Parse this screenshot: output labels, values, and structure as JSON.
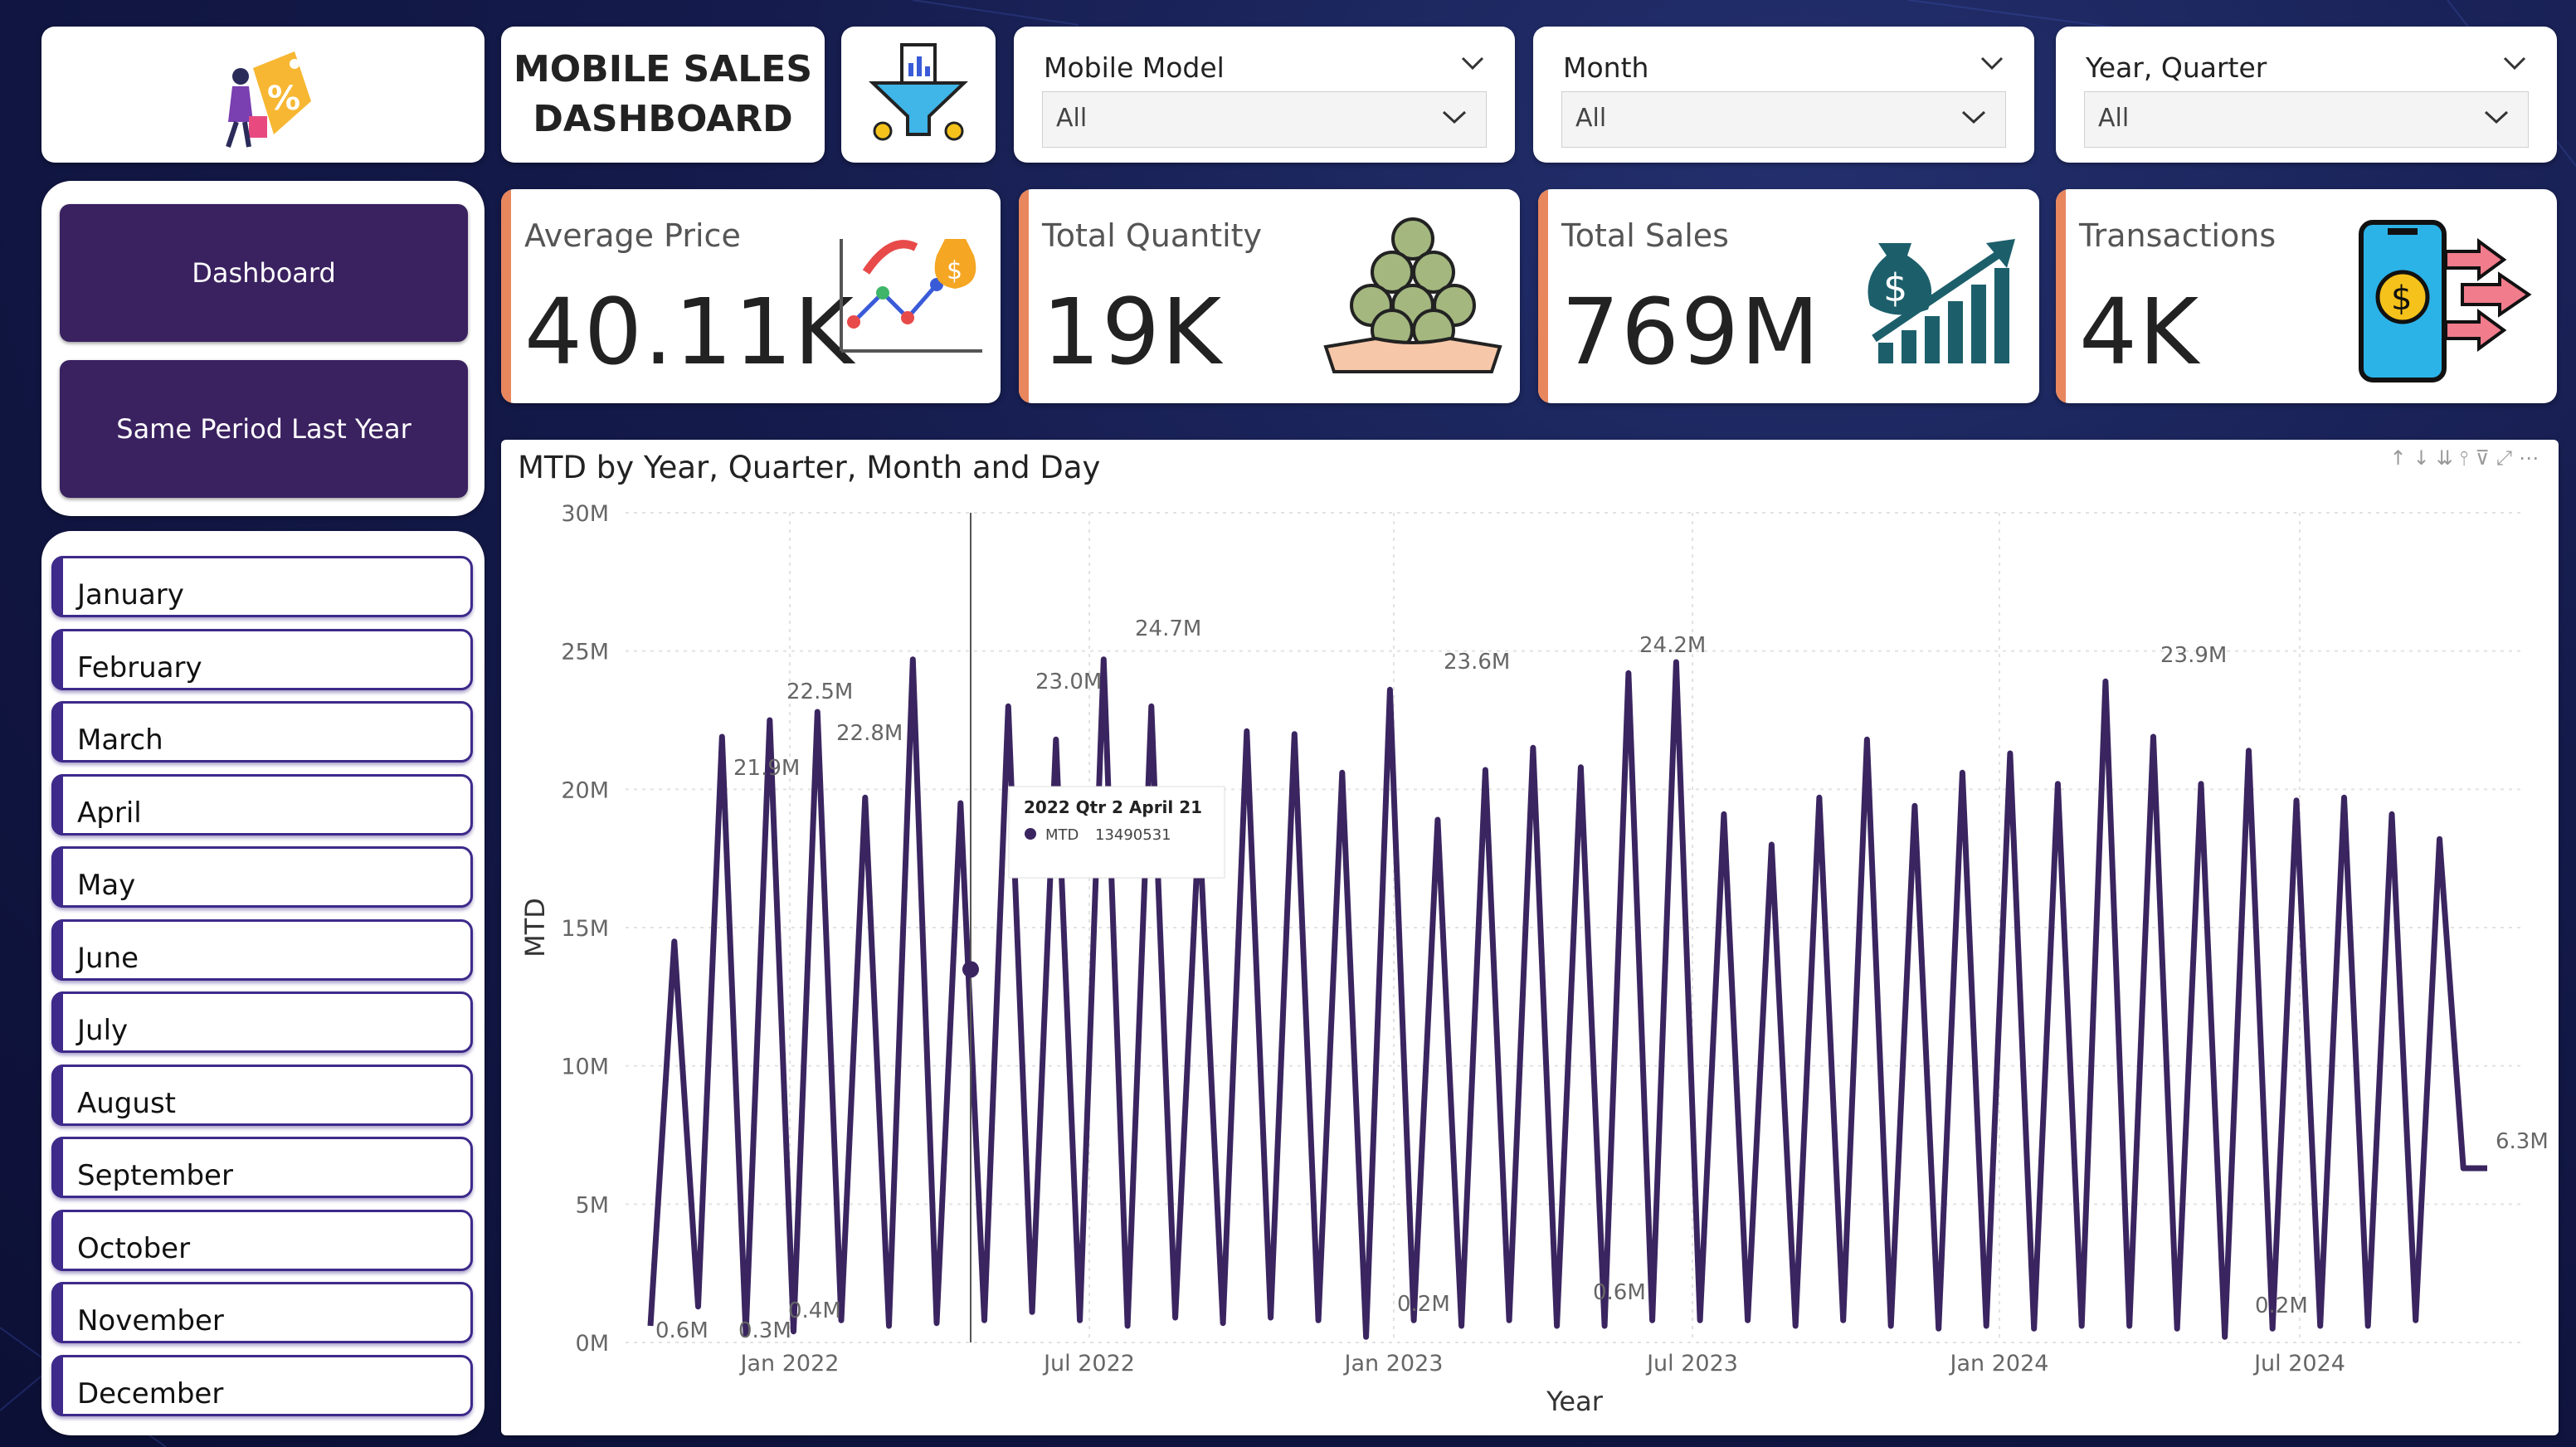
{
  "title": {
    "line1": "MOBILE SALES",
    "line2": "DASHBOARD"
  },
  "logo_icon": "discount-tag-shopper-icon",
  "filter_icon": "funnel-chart-icon",
  "slicers": [
    {
      "header": "Mobile Model",
      "value": "All"
    },
    {
      "header": "Month",
      "value": "All"
    },
    {
      "header": "Year, Quarter",
      "value": "All"
    }
  ],
  "nav": {
    "dashboard": "Dashboard",
    "same_period": "Same Period Last Year"
  },
  "months": [
    "January",
    "February",
    "March",
    "April",
    "May",
    "June",
    "July",
    "August",
    "September",
    "October",
    "November",
    "December"
  ],
  "kpis": [
    {
      "label": "Average Price",
      "value": "40.11K",
      "icon": "line-chart-money-bag-icon"
    },
    {
      "label": "Total Quantity",
      "value": "19K",
      "icon": "coins-hand-icon"
    },
    {
      "label": "Total Sales",
      "value": "769M",
      "icon": "money-bag-growth-icon"
    },
    {
      "label": "Transactions",
      "value": "4K",
      "icon": "phone-payment-icon"
    }
  ],
  "accent_color": "#e8865e",
  "nav_color": "#3a2160",
  "line_color": "#3a2560",
  "chart_data": {
    "type": "line",
    "title": "MTD by Year, Quarter, Month and Day",
    "xlabel": "Year",
    "ylabel": "MTD",
    "y_ticks": [
      "0M",
      "5M",
      "10M",
      "15M",
      "20M",
      "25M",
      "30M"
    ],
    "ylim": [
      0,
      30
    ],
    "x_ticks": [
      "Jan 2022",
      "Jul 2022",
      "Jan 2023",
      "Jul 2023",
      "Jan 2024",
      "Jul 2024"
    ],
    "series": [
      {
        "values": [
          0.6,
          14.5,
          1.3,
          21.9,
          0.3,
          22.5,
          0.4,
          22.8,
          0.8,
          19.7,
          0.6,
          24.7,
          0.7,
          19.5,
          0.8,
          23.0,
          1.1,
          21.8,
          0.8,
          24.7,
          0.6,
          23.0,
          0.9,
          18.8,
          0.7,
          22.1,
          0.9,
          22.0,
          0.8,
          20.6,
          0.2,
          23.6,
          0.8,
          18.9,
          0.6,
          20.7,
          0.8,
          21.5,
          0.6,
          20.8,
          0.6,
          24.2,
          0.8,
          24.6,
          0.8,
          19.1,
          0.8,
          18.0,
          0.6,
          19.7,
          0.8,
          21.8,
          0.6,
          19.4,
          0.5,
          20.6,
          0.6,
          21.3,
          0.5,
          20.2,
          0.6,
          23.9,
          0.6,
          21.9,
          0.5,
          20.2,
          0.2,
          21.4,
          0.5,
          19.6,
          0.6,
          19.7,
          0.6,
          19.1,
          0.8,
          18.2,
          6.3,
          6.3
        ]
      }
    ],
    "data_labels": [
      "0.6M",
      "0.3M",
      "21.9M",
      "0.4M",
      "22.5M",
      "22.8M",
      "23.0M",
      "24.7M",
      "0.2M",
      "23.6M",
      "0.6M",
      "24.2M",
      "23.9M",
      "0.2M",
      "6.3M"
    ],
    "tooltip": {
      "title": "2022 Qtr 2 April 21",
      "series": "MTD",
      "value": "13490531",
      "y_value": 13.49
    },
    "grid": true
  }
}
